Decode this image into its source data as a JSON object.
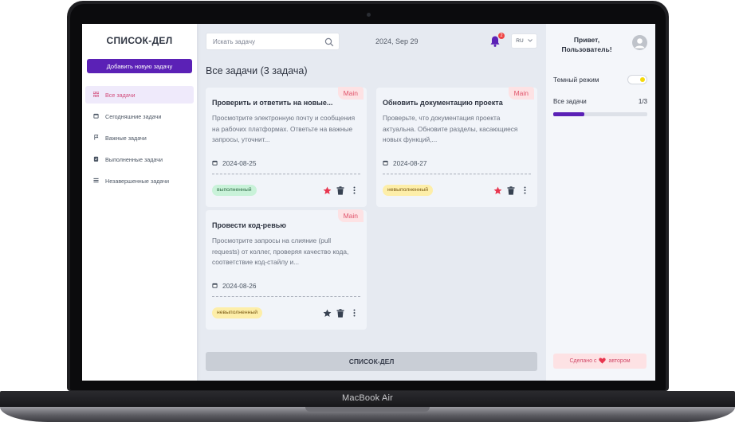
{
  "device": {
    "label": "MacBook Air"
  },
  "app": {
    "logo": "СПИСОК-ДЕЛ",
    "add_task_label": "Добавить новую задачу",
    "nav": [
      {
        "label": "Все задачи",
        "icon": "grid-icon",
        "active": true
      },
      {
        "label": "Сегодняшние задачи",
        "icon": "calendar-icon"
      },
      {
        "label": "Важные задачи",
        "icon": "flag-icon"
      },
      {
        "label": "Выполненные задачи",
        "icon": "clipboard-check-icon"
      },
      {
        "label": "Незавершенные задачи",
        "icon": "list-icon"
      }
    ]
  },
  "topbar": {
    "search_placeholder": "Искать задачу",
    "date": "2024, Sep 29",
    "notifications": "2",
    "language": "RU"
  },
  "main": {
    "heading": "Все задачи (3 задача)",
    "footer_label": "СПИСОК-ДЕЛ",
    "tasks": [
      {
        "tag": "Main",
        "title": "Проверить и ответить на новые...",
        "description": "Просмотрите электронную почту и сообщения на рабочих платформах. Ответьте на важные запросы, уточнит...",
        "date": "2024-08-25",
        "status": "выполненный",
        "important": true
      },
      {
        "tag": "Main",
        "title": "Обновить документацию проекта",
        "description": "Проверьте, что документация проекта актуальна. Обновите разделы, касающиеся новых функций,...",
        "date": "2024-08-27",
        "status": "невыполненный",
        "important": true
      },
      {
        "tag": "Main",
        "title": "Провести код-ревью",
        "description": "Просмотрите запросы на слияние (pull requests) от коллег, проверяя качество кода, соответствие код-стайлу и...",
        "date": "2024-08-26",
        "status": "невыполненный",
        "important": false
      }
    ]
  },
  "panel": {
    "greeting": "Привет, Пользователь!",
    "dark_mode_label": "Темный режим",
    "progress_label": "Все задачи",
    "progress_value": "1/3",
    "progress_fraction": 0.333,
    "made_prefix": "Сделано с",
    "made_suffix": "автором"
  },
  "colors": {
    "accent": "#5b21b6",
    "important_star": "#e8354e",
    "default_star": "#374151",
    "tag_bg": "#fde2e4"
  }
}
